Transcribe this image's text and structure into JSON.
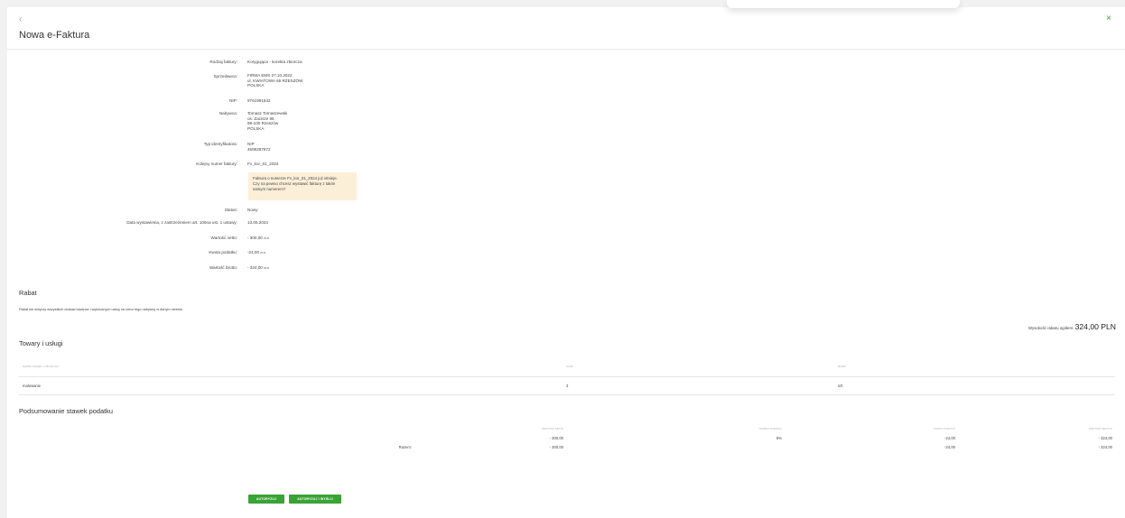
{
  "header": {
    "back_icon": "‹",
    "close_icon": "×",
    "title": "Nowa e-Faktura"
  },
  "details": {
    "labels": [
      "Rodzaj faktury:",
      "Sprzedawca:",
      "NIP:",
      "Nabywca:",
      "Typ identyfikatora:",
      "Kolejny numer faktury:",
      "Status:",
      "Data wystawienia, z zastrzeżeniem art. 106na ust. 1 ustawy:",
      "Wartość netto:",
      "Kwota podatku:",
      "Wartość brutto:"
    ],
    "invoice_type": "Korygująca - korekta zbiorcza",
    "seller": [
      "FIRMA EMS 27.10.2022",
      "ul. KWIATOWA 65 RZESZÓW",
      "POLSKA"
    ],
    "nip": "9761991842",
    "buyer": [
      "Tomasz Tomaszewski",
      "os. Zacisze 96",
      "99-100 Rzeszów",
      "POLSKA"
    ],
    "id_type": [
      "NIP",
      "4599287872"
    ],
    "invoice_number": "Fv_kor_01_2024",
    "warning": [
      "Faktura o numerze Fv_kor_01_2024 już istnieje.",
      "Czy na pewno chcesz wystawić fakturę z takim",
      "samym numerem?"
    ],
    "status": "Nowy",
    "issue_date": "13.05.2024",
    "net_value": "- 300,00",
    "tax_amount": "-24,00",
    "gross_value": "- 324,00",
    "currency": "PLN"
  },
  "rabat": {
    "title": "Rabat",
    "note": "Rabat nie dotyczy wszystkich dostaw towarów i wykonanych usług na rzecz tego nabywcy w danym okresie.",
    "total_label": "Wysokość rabatu ogółem:",
    "total_value": "324,00 PLN"
  },
  "goods": {
    "title": "Towary i usługi",
    "headers": [
      "NAZWA TOWARU LUB USŁUGI",
      "ILOŚĆ",
      "MIARA"
    ],
    "row": {
      "name": "malowanie",
      "qty": "3",
      "unit": "szt"
    }
  },
  "tax_summary": {
    "title": "Podsumowanie stawek podatku",
    "headers": [
      "WARTOŚĆ NETTO",
      "STAWKA PODATKU",
      "KWOTA PODATKU",
      "WARTOŚĆ BRUTTO"
    ],
    "row": {
      "net": "- 300,00",
      "rate": "8%",
      "tax": "-24,00",
      "gross": "- 324,00"
    },
    "sum_label": "Razem:",
    "sum": {
      "net": "- 300,00",
      "tax": "-24,00",
      "gross": "- 324,00"
    }
  },
  "actions": {
    "authorize": "AUTORYZUJ",
    "authorize_send": "AUTORYZUJ I WYŚLIJ"
  },
  "colors": {
    "accent": "#3aa335",
    "warning_bg": "#fcefd8"
  }
}
